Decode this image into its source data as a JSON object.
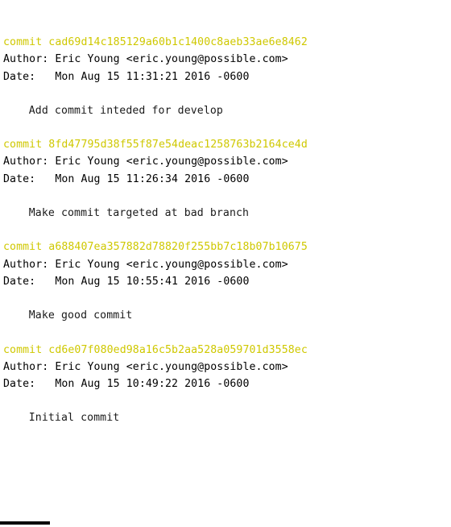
{
  "terminal": {
    "command_output_type": "git-log",
    "colors": {
      "background": "#ffffff",
      "commit_hash": "#cfc800",
      "text": "#000000",
      "cursor": "#000000"
    },
    "author_label": "Author:",
    "date_label": "Date:",
    "commit_label": "commit"
  },
  "commits": [
    {
      "commit_line": "commit cad69d14c185129a60b1c1400c8aeb33ae6e8462",
      "hash": "cad69d14c185129a60b1c1400c8aeb33ae6e8462",
      "author_line": "Author: Eric Young <eric.young@possible.com>",
      "author_name": "Eric Young",
      "author_email": "eric.young@possible.com",
      "date_line": "Date:   Mon Aug 15 11:31:21 2016 -0600",
      "date": "Mon Aug 15 11:31:21 2016 -0600",
      "message": "Add commit inteded for develop"
    },
    {
      "commit_line": "commit 8fd47795d38f55f87e54deac1258763b2164ce4d",
      "hash": "8fd47795d38f55f87e54deac1258763b2164ce4d",
      "author_line": "Author: Eric Young <eric.young@possible.com>",
      "author_name": "Eric Young",
      "author_email": "eric.young@possible.com",
      "date_line": "Date:   Mon Aug 15 11:26:34 2016 -0600",
      "date": "Mon Aug 15 11:26:34 2016 -0600",
      "message": "Make commit targeted at bad branch"
    },
    {
      "commit_line": "commit a688407ea357882d78820f255bb7c18b07b10675",
      "hash": "a688407ea357882d78820f255bb7c18b07b10675",
      "author_line": "Author: Eric Young <eric.young@possible.com>",
      "author_name": "Eric Young",
      "author_email": "eric.young@possible.com",
      "date_line": "Date:   Mon Aug 15 10:55:41 2016 -0600",
      "date": "Mon Aug 15 10:55:41 2016 -0600",
      "message": "Make good commit"
    },
    {
      "commit_line": "commit cd6e07f080ed98a16c5b2aa528a059701d3558ec",
      "hash": "cd6e07f080ed98a16c5b2aa528a059701d3558ec",
      "author_line": "Author: Eric Young <eric.young@possible.com>",
      "author_name": "Eric Young",
      "author_email": "eric.young@possible.com",
      "date_line": "Date:   Mon Aug 15 10:49:22 2016 -0600",
      "date": "Mon Aug 15 10:49:22 2016 -0600",
      "message": "Initial commit"
    }
  ]
}
